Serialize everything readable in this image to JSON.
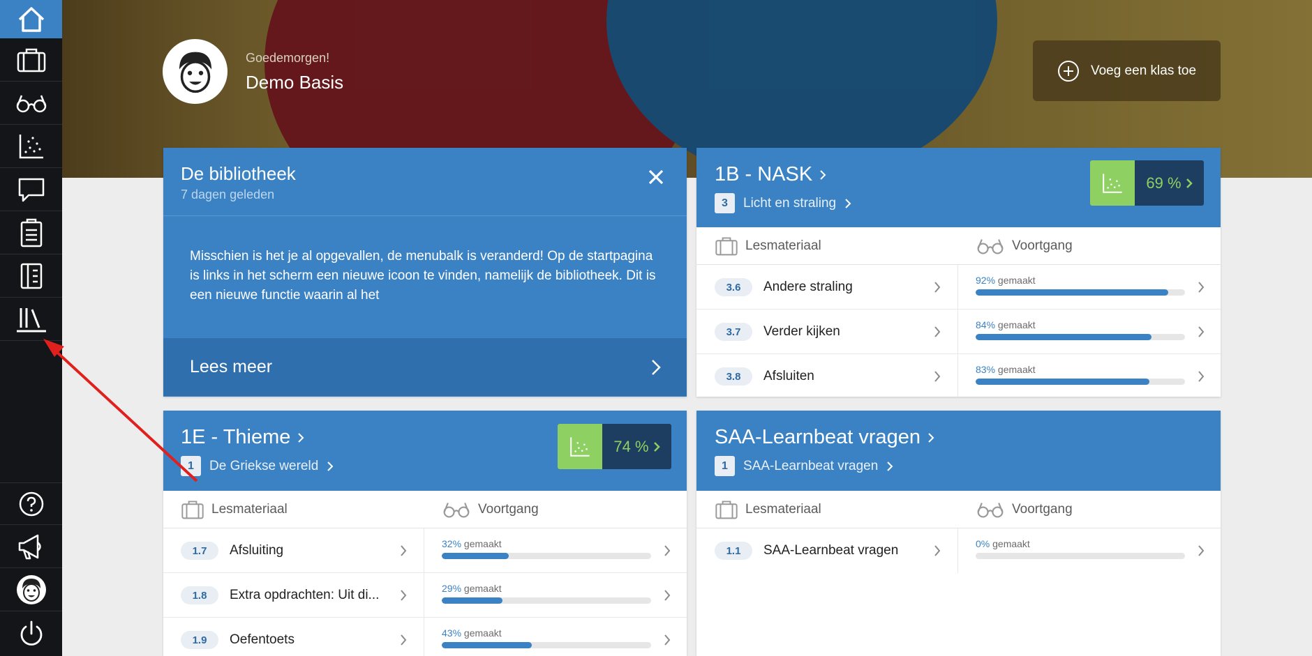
{
  "header": {
    "greeting": "Goedemorgen!",
    "user_name": "Demo Basis",
    "add_class_label": "Voeg een klas toe"
  },
  "sidebar": {
    "top_items": [
      "home-icon",
      "briefcase-icon",
      "glasses-icon",
      "scatter-chart-icon",
      "chat-bubble-icon",
      "clipboard-icon",
      "book-tabs-icon",
      "library-icon"
    ],
    "bottom_items": [
      "help-icon",
      "megaphone-icon",
      "avatar-icon",
      "power-icon"
    ]
  },
  "library_card": {
    "title": "De bibliotheek",
    "subtitle": "7 dagen geleden",
    "body": "Misschien is het je al opgevallen, de menubalk is veranderd! Op de startpagina is links in het scherm een nieuwe icoon te vinden, namelijk de bibliotheek. Dit is een nieuwe functie waarin al het",
    "read_more": "Lees meer"
  },
  "column_labels": {
    "material": "Lesmateriaal",
    "progress": "Voortgang",
    "done_suffix": "gemaakt"
  },
  "classes": [
    {
      "title": "1B - NASK",
      "chapter_num": "3",
      "chapter": "Licht en straling",
      "score": "69 %",
      "rows": [
        {
          "num": "3.6",
          "name": "Andere straling",
          "pct": "92%",
          "value": 92
        },
        {
          "num": "3.7",
          "name": "Verder kijken",
          "pct": "84%",
          "value": 84
        },
        {
          "num": "3.8",
          "name": "Afsluiten",
          "pct": "83%",
          "value": 83
        }
      ]
    },
    {
      "title": "1E - Thieme",
      "chapter_num": "1",
      "chapter": "De Griekse wereld",
      "score": "74 %",
      "rows": [
        {
          "num": "1.7",
          "name": "Afsluiting",
          "pct": "32%",
          "value": 32
        },
        {
          "num": "1.8",
          "name": "Extra opdrachten: Uit di...",
          "pct": "29%",
          "value": 29
        },
        {
          "num": "1.9",
          "name": "Oefentoets",
          "pct": "43%",
          "value": 43
        }
      ]
    },
    {
      "title": "SAA-Learnbeat vragen",
      "chapter_num": "1",
      "chapter": "SAA-Learnbeat vragen",
      "rows": [
        {
          "num": "1.1",
          "name": "SAA-Learnbeat vragen",
          "pct": "0%",
          "value": 0
        }
      ]
    }
  ],
  "colors": {
    "brand_blue": "#3b82c4",
    "dark_blue": "#1d3e60",
    "score_green": "#8ed062",
    "sidebar": "#131518",
    "annotation_arrow": "#e0201c"
  }
}
